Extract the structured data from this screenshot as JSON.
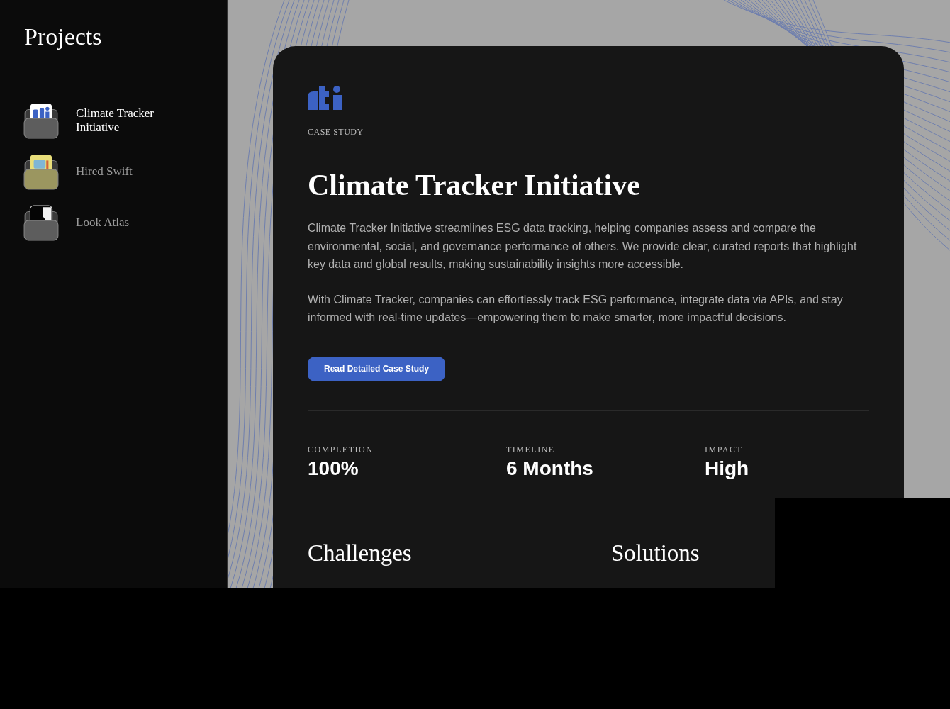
{
  "sidebar": {
    "title": "Projects",
    "items": [
      {
        "label": "Climate Tracker Initiative",
        "selected": true
      },
      {
        "label": "Hired Swift",
        "selected": false
      },
      {
        "label": "Look Atlas",
        "selected": false
      }
    ]
  },
  "case_study": {
    "eyebrow": "CASE STUDY",
    "title": "Climate Tracker Initiative",
    "paragraphs": [
      "Climate Tracker Initiative streamlines ESG data tracking, helping companies assess and compare the environmental, social, and governance performance of others. We provide clear, curated reports that highlight key data and global results, making sustainability insights more accessible.",
      "With Climate Tracker, companies can effortlessly track ESG performance, integrate data via APIs, and stay informed with real-time updates—empowering them to make smarter, more impactful decisions."
    ],
    "button": "Read Detailed Case Study",
    "stats": [
      {
        "label": "COMPLETION",
        "value": "100%"
      },
      {
        "label": "TIMELINE",
        "value": "6 Months"
      },
      {
        "label": "IMPACT",
        "value": "High"
      }
    ],
    "sections": [
      "Challenges",
      "Solutions"
    ]
  }
}
